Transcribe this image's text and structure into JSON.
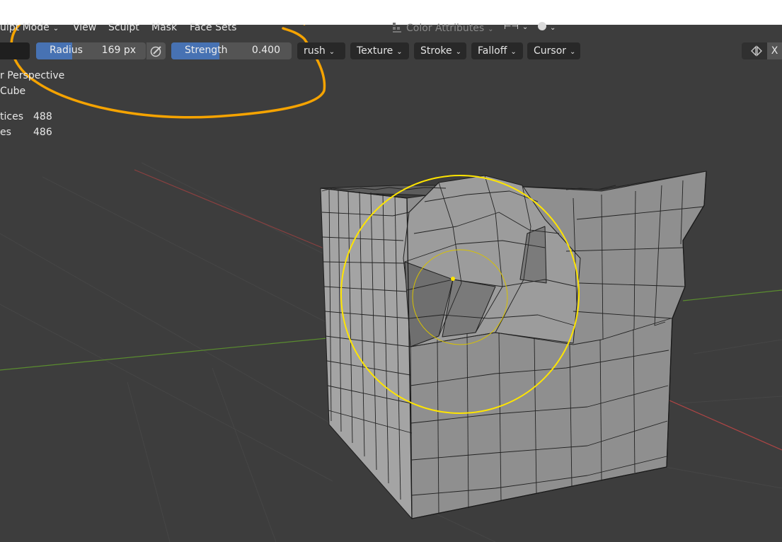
{
  "header": {
    "menus": [
      {
        "label": "ulpt Mode",
        "dropdown": true
      },
      {
        "label": "View"
      },
      {
        "label": "Sculpt"
      },
      {
        "label": "Mask"
      },
      {
        "label": "Face Sets"
      }
    ],
    "color_attributes": "Color Attributes"
  },
  "toolbar": {
    "radius": {
      "label": "Radius",
      "value": "169 px",
      "fill_fraction": 0.33
    },
    "strength": {
      "label": "Strength",
      "value": "0.400",
      "fill_fraction": 0.4
    },
    "dropdowns": [
      "rush",
      "Texture",
      "Stroke",
      "Falloff",
      "Cursor"
    ],
    "axis": "X"
  },
  "viewport": {
    "view_name": "r Perspective",
    "object_name": "Cube",
    "stats": [
      {
        "label": "tices",
        "value": "488"
      },
      {
        "label": "es",
        "value": "486"
      }
    ]
  },
  "colors": {
    "background": "#3d3d3d",
    "slider_fill": "#4772b3",
    "brush_cursor": "#ffe500",
    "annotation": "#f5a300",
    "grid_x_axis": "#b04545",
    "grid_y_axis": "#5a8c2f"
  },
  "icons": [
    "chevron-down-icon",
    "color-attributes-icon",
    "symmetry-icon",
    "shading-sphere-icon",
    "pen-pressure-icon",
    "mirror-icon"
  ]
}
